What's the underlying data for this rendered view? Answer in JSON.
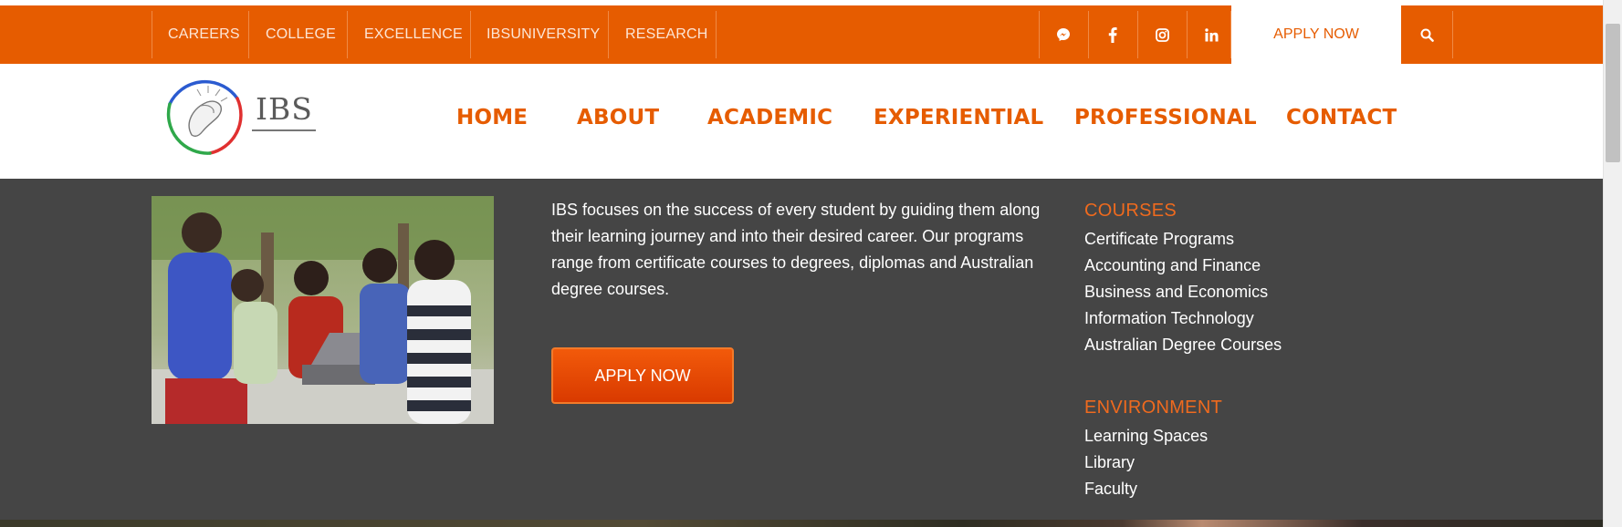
{
  "topbar": {
    "links": [
      "CAREERS",
      "COLLEGE",
      "EXCELLENCE",
      "IBSUNIVERSITY",
      "RESEARCH"
    ],
    "social_icons": [
      "messenger-icon",
      "facebook-icon",
      "instagram-icon",
      "linkedin-icon"
    ],
    "apply_label": "APPLY NOW",
    "search_icon": "search-icon"
  },
  "header": {
    "logo_text": "IBS",
    "nav": [
      "HOME",
      "ABOUT",
      "ACADEMIC",
      "EXPERIENTIAL",
      "PROFESSIONAL",
      "CONTACT"
    ]
  },
  "panel": {
    "blurb": "IBS focuses on the success of every student by guiding them along their learning journey and into their desired career. Our programs range from certificate courses to degrees, diplomas and Australian degree courses.",
    "apply_label": "APPLY NOW",
    "courses": {
      "title": "COURSES",
      "items": [
        "Certificate Programs",
        "Accounting and Finance",
        "Business and Economics",
        "Information Technology",
        "Australian Degree Courses"
      ]
    },
    "environment": {
      "title": "ENVIRONMENT",
      "items": [
        "Learning Spaces",
        "Library",
        "Faculty"
      ]
    }
  },
  "colors": {
    "brand_orange": "#e65c00",
    "panel_bg": "#454545",
    "link_white": "#ffffff"
  }
}
